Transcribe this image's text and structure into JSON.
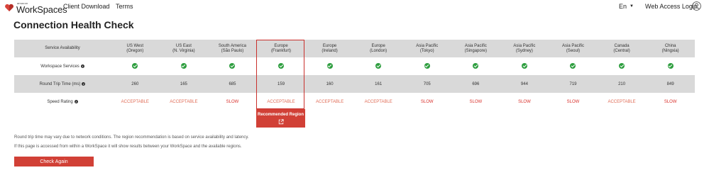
{
  "header": {
    "logo_small": "amazon",
    "logo_text": "WorkSpaces",
    "nav": [
      "Client Download",
      "Terms"
    ],
    "language": "En",
    "login": "Web Access Login"
  },
  "page": {
    "title": "Connection Health Check"
  },
  "table": {
    "corner_label": "Service Availability",
    "regions": [
      {
        "name": "US West",
        "sub": "(Oregon)"
      },
      {
        "name": "US East",
        "sub": "(N. Virginia)"
      },
      {
        "name": "South America",
        "sub": "(São Paulo)"
      },
      {
        "name": "Europe",
        "sub": "(Frankfurt)"
      },
      {
        "name": "Europe",
        "sub": "(Ireland)"
      },
      {
        "name": "Europe",
        "sub": "(London)"
      },
      {
        "name": "Asia Pacific",
        "sub": "(Tokyo)"
      },
      {
        "name": "Asia Pacific",
        "sub": "(Singapore)"
      },
      {
        "name": "Asia Pacific",
        "sub": "(Sydney)"
      },
      {
        "name": "Asia Pacific",
        "sub": "(Seoul)"
      },
      {
        "name": "Canada",
        "sub": "(Central)"
      },
      {
        "name": "China",
        "sub": "(Ningxia)"
      }
    ],
    "row_labels": {
      "services": "Workspace Services",
      "rtt": "Round Trip Time (ms)",
      "speed": "Speed Rating"
    },
    "rtt": [
      "260",
      "165",
      "685",
      "159",
      "160",
      "161",
      "705",
      "696",
      "944",
      "719",
      "210",
      "849"
    ],
    "speed": [
      "ACCEPTABLE",
      "ACCEPTABLE",
      "SLOW",
      "ACCEPTABLE",
      "ACCEPTABLE",
      "ACCEPTABLE",
      "SLOW",
      "SLOW",
      "SLOW",
      "SLOW",
      "ACCEPTABLE",
      "SLOW"
    ],
    "status_icon": "check-circle-icon",
    "acceptable_color": "#e06b55",
    "slow_color": "#d9302b"
  },
  "recommended": {
    "label": "Recommended Region",
    "region_index": 3,
    "icon": "external-link-icon"
  },
  "notes": [
    "Round trip time may vary due to network conditions. The region recommendation is based on service availability and latency.",
    "If this page is accessed from within a WorkSpace it will show results between your WorkSpace and the available regions."
  ],
  "button": {
    "label": "Check Again"
  },
  "colors": {
    "accent": "#d14036",
    "ok": "#2e9e3f",
    "header_bg": "#d9d9d9"
  }
}
